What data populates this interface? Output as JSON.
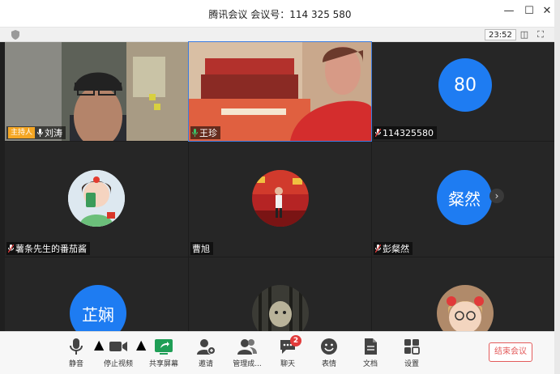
{
  "window": {
    "title": "腾讯会议 会议号：114 325 580",
    "timer": "23:52"
  },
  "participants": [
    {
      "name": "刘涛",
      "host_label": "主持人"
    },
    {
      "name": "王珍"
    },
    {
      "name": "114325580",
      "avatar_text": "80"
    },
    {
      "name": "薯条先生的番茄酱"
    },
    {
      "name": "曹旭"
    },
    {
      "name": "彭粲然",
      "avatar_text": "粲然"
    },
    {
      "name": "",
      "avatar_text": "芷娴"
    },
    {
      "name": ""
    },
    {
      "name": ""
    }
  ],
  "toolbar": {
    "mute": "静音",
    "stop_video": "停止视频",
    "share_screen": "共享屏幕",
    "invite": "邀请",
    "manage_members": "管理成...",
    "chat": "聊天",
    "chat_badge": "2",
    "reactions": "表情",
    "docs": "文档",
    "settings": "设置",
    "end_meeting": "结束会议"
  },
  "colors": {
    "avatar_blue": "#1e7cf2",
    "host_badge": "#f5a623",
    "end_button": "#e35b5b",
    "notification": "#e23b3b"
  }
}
